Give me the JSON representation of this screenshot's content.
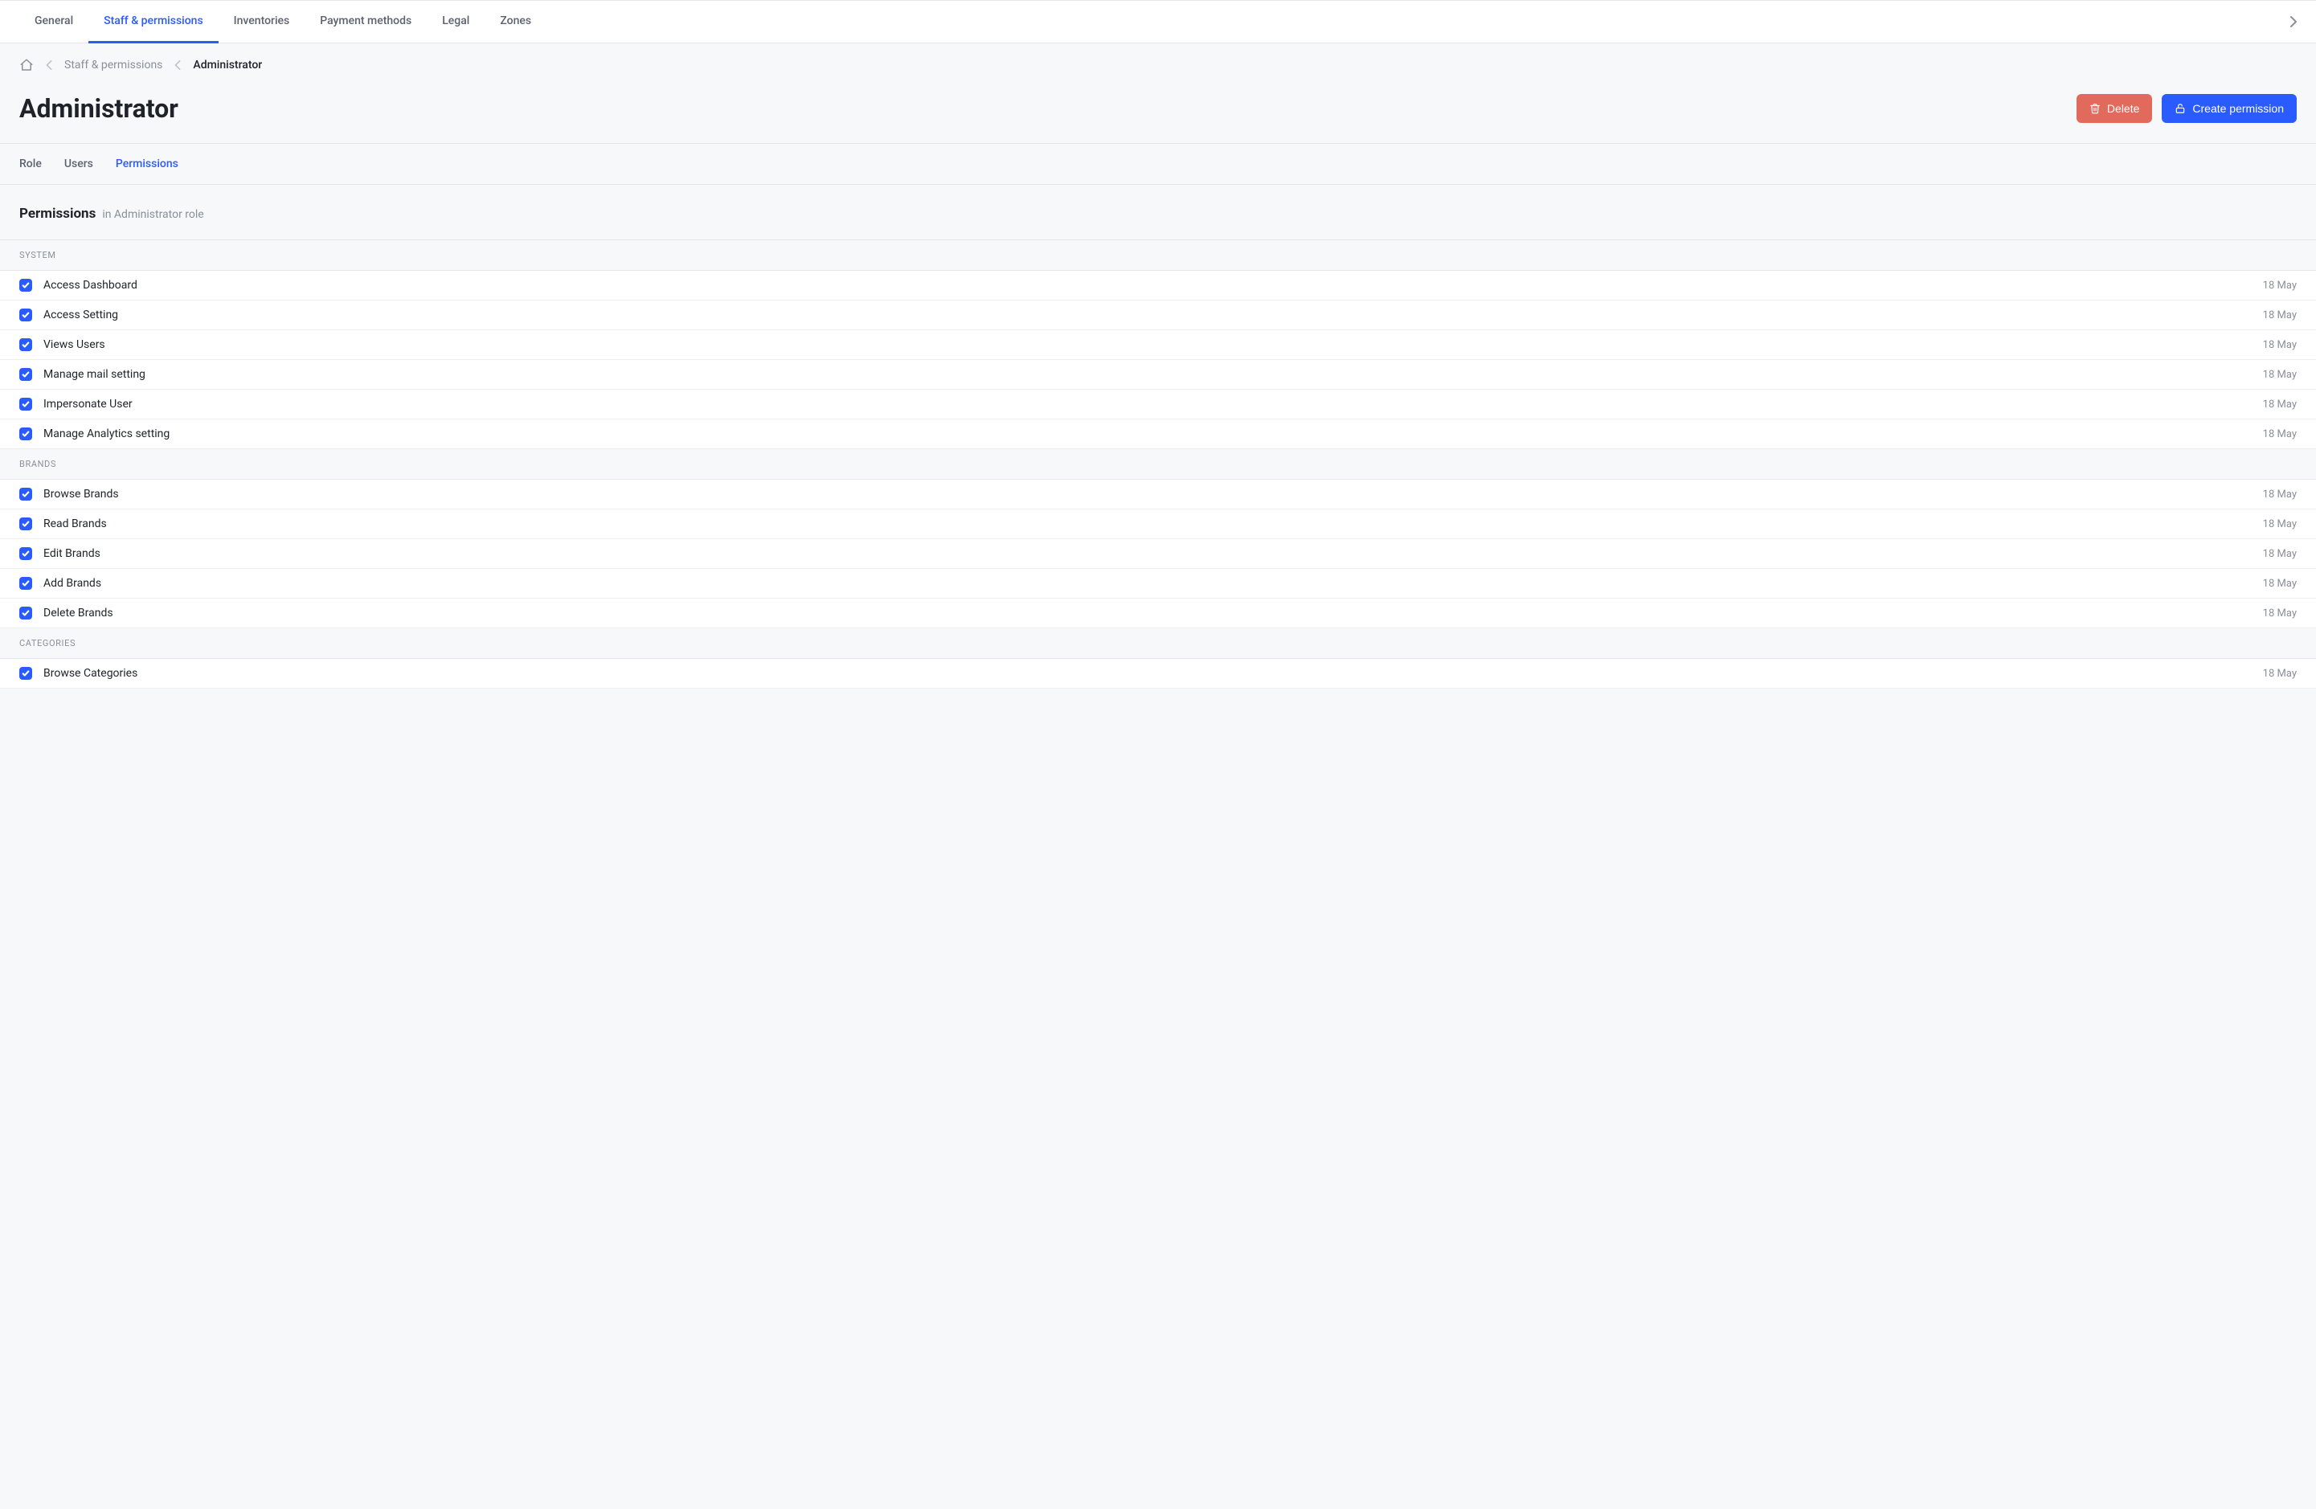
{
  "topnav": {
    "items": [
      {
        "label": "General",
        "active": false
      },
      {
        "label": "Staff & permissions",
        "active": true
      },
      {
        "label": "Inventories",
        "active": false
      },
      {
        "label": "Payment methods",
        "active": false
      },
      {
        "label": "Legal",
        "active": false
      },
      {
        "label": "Zones",
        "active": false
      }
    ]
  },
  "breadcrumbs": {
    "items": [
      {
        "label": "Staff & permissions",
        "current": false
      },
      {
        "label": "Administrator",
        "current": true
      }
    ]
  },
  "page": {
    "title": "Administrator",
    "delete_label": "Delete",
    "create_label": "Create permission"
  },
  "subtabs": {
    "items": [
      {
        "label": "Role",
        "active": false
      },
      {
        "label": "Users",
        "active": false
      },
      {
        "label": "Permissions",
        "active": true
      }
    ]
  },
  "section": {
    "title": "Permissions",
    "subtitle": "in Administrator role"
  },
  "groups": [
    {
      "label": "SYSTEM",
      "rows": [
        {
          "label": "Access Dashboard",
          "date": "18 May",
          "checked": true
        },
        {
          "label": "Access Setting",
          "date": "18 May",
          "checked": true
        },
        {
          "label": "Views Users",
          "date": "18 May",
          "checked": true
        },
        {
          "label": "Manage mail setting",
          "date": "18 May",
          "checked": true
        },
        {
          "label": "Impersonate User",
          "date": "18 May",
          "checked": true
        },
        {
          "label": "Manage Analytics setting",
          "date": "18 May",
          "checked": true
        }
      ]
    },
    {
      "label": "BRANDS",
      "rows": [
        {
          "label": "Browse Brands",
          "date": "18 May",
          "checked": true
        },
        {
          "label": "Read Brands",
          "date": "18 May",
          "checked": true
        },
        {
          "label": "Edit Brands",
          "date": "18 May",
          "checked": true
        },
        {
          "label": "Add Brands",
          "date": "18 May",
          "checked": true
        },
        {
          "label": "Delete Brands",
          "date": "18 May",
          "checked": true
        }
      ]
    },
    {
      "label": "CATEGORIES",
      "rows": [
        {
          "label": "Browse Categories",
          "date": "18 May",
          "checked": true
        }
      ]
    }
  ]
}
